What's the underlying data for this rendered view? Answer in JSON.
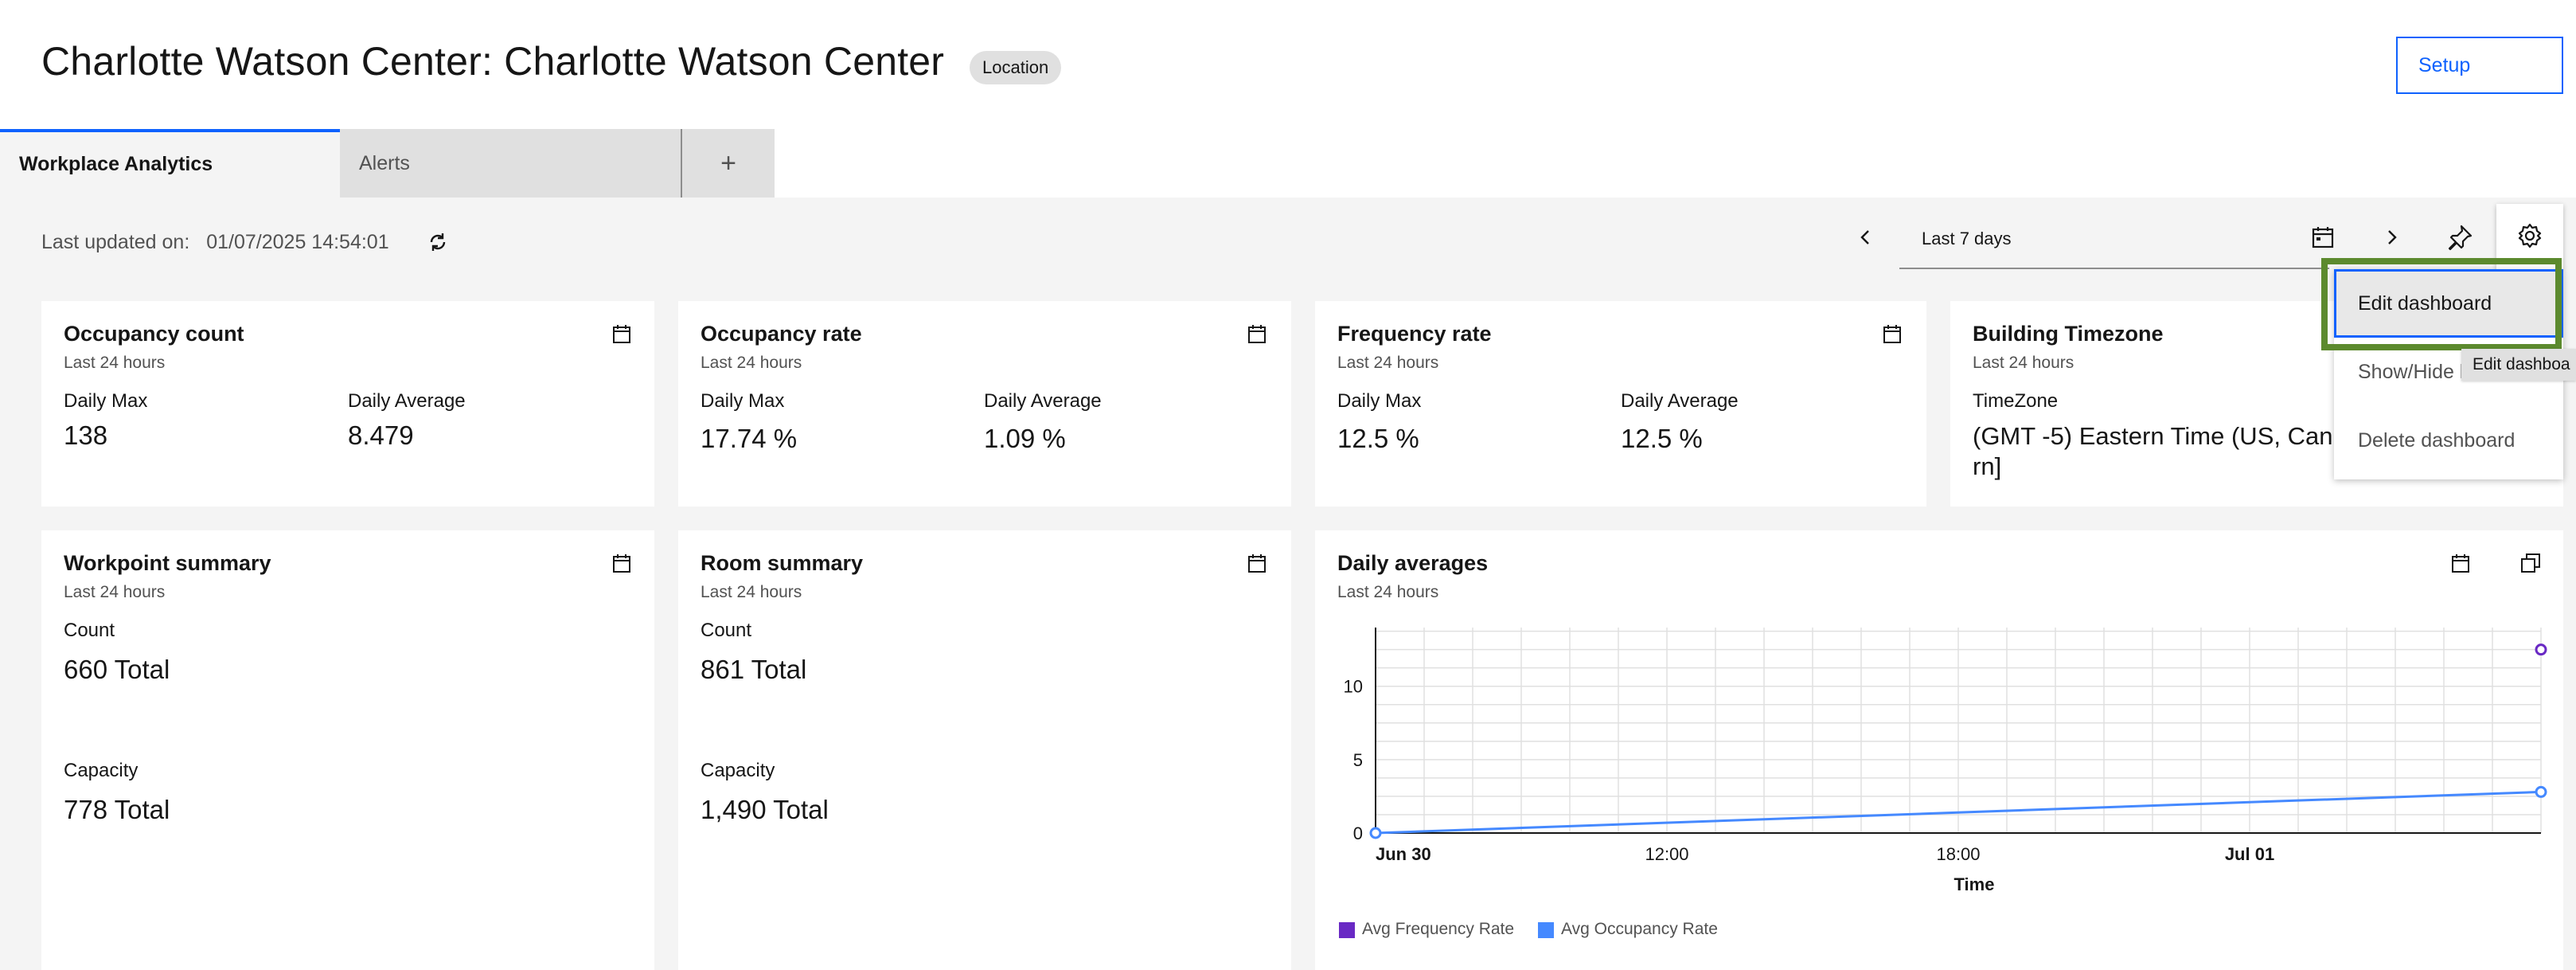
{
  "header": {
    "title": "Charlotte Watson Center: Charlotte Watson Center",
    "tag": "Location",
    "setup_label": "Setup"
  },
  "tabs": [
    {
      "label": "Workplace Analytics",
      "active": true
    },
    {
      "label": "Alerts"
    },
    {
      "label": "+"
    }
  ],
  "toolbar": {
    "updated_label": "Last updated on:",
    "updated_value": "01/07/2025 14:54:01",
    "date_range": "Last 7 days"
  },
  "cards": {
    "occupancy_count": {
      "title": "Occupancy count",
      "sub": "Last 24 hours",
      "max_label": "Daily Max",
      "max_value": "138",
      "avg_label": "Daily Average",
      "avg_value": "8.479"
    },
    "occupancy_rate": {
      "title": "Occupancy rate",
      "sub": "Last 24 hours",
      "max_label": "Daily Max",
      "max_value": "17.74 %",
      "avg_label": "Daily Average",
      "avg_value": "1.09 %"
    },
    "frequency_rate": {
      "title": "Frequency rate",
      "sub": "Last 24 hours",
      "max_label": "Daily Max",
      "max_value": "12.5 %",
      "avg_label": "Daily Average",
      "avg_value": "12.5 %"
    },
    "building_timezone": {
      "title": "Building Timezone",
      "sub": "Last 24 hours",
      "tz_label": "TimeZone",
      "tz_value_line1": "(GMT -5) Eastern Time (US, Can",
      "tz_value_line2": "rn]"
    },
    "workpoint_summary": {
      "title": "Workpoint summary",
      "sub": "Last 24 hours",
      "count_label": "Count",
      "count_value": "660 Total",
      "capacity_label": "Capacity",
      "capacity_value": "778 Total"
    },
    "room_summary": {
      "title": "Room summary",
      "sub": "Last 24 hours",
      "count_label": "Count",
      "count_value": "861 Total",
      "capacity_label": "Capacity",
      "capacity_value": "1,490 Total"
    },
    "daily_averages": {
      "title": "Daily averages",
      "sub": "Last 24 hours"
    }
  },
  "menu": {
    "items": [
      "Edit dashboard",
      "Show/Hide last ...",
      "Delete dashboard"
    ],
    "tooltip": "Edit dashboa"
  },
  "chart_data": {
    "type": "line",
    "title": "Daily averages",
    "xlabel": "Time",
    "ylabel": "",
    "x_ticks": [
      "Jun 30",
      "12:00",
      "18:00",
      "Jul 01"
    ],
    "y_ticks": [
      "0",
      "5",
      "10"
    ],
    "ylim": [
      0,
      14
    ],
    "grid": true,
    "legend_position": "bottom-left",
    "series": [
      {
        "name": "Avg Frequency Rate",
        "color": "#6929c4",
        "points": [
          {
            "x": "Jul 01 ~04:00",
            "y": 12.5
          }
        ]
      },
      {
        "name": "Avg Occupancy Rate",
        "color": "#4589ff",
        "points": [
          {
            "x": "Jun 30 06:00",
            "y": 0
          },
          {
            "x": "Jul 01 ~04:00",
            "y": 2.8
          }
        ]
      }
    ]
  },
  "colors": {
    "accent": "#0f62fe",
    "highlight": "#5c8a2e",
    "series_frequency": "#6929c4",
    "series_occupancy": "#4589ff"
  }
}
